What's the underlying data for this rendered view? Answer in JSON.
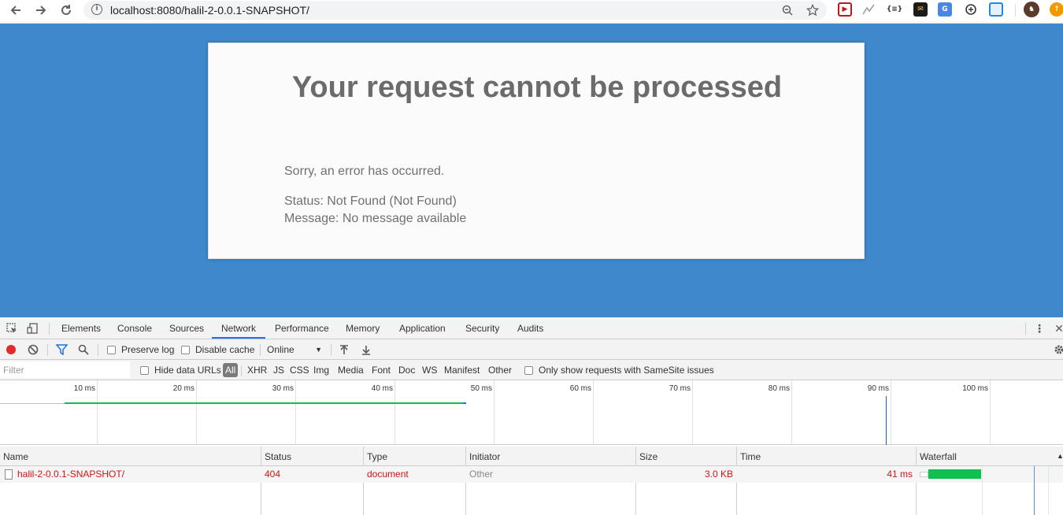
{
  "browser": {
    "url": "localhost:8080/halil-2-0.0.1-SNAPSHOT/",
    "extensions": [
      "zoom-icon",
      "bookmark-star-icon",
      "video-extension-icon",
      "trend-extension-icon",
      "json-extension-icon",
      "mail-extension-icon",
      "translate-extension-icon",
      "sync-extension-icon",
      "window-extension-icon",
      "profile-avatar-icon",
      "update-icon"
    ]
  },
  "page": {
    "title": "Your request cannot be processed",
    "sorry": "Sorry, an error has occurred.",
    "status": "Status: Not Found (Not Found)",
    "message": "Message: No message available",
    "background": "#3f88cb"
  },
  "devtools": {
    "tabs": [
      "Elements",
      "Console",
      "Sources",
      "Network",
      "Performance",
      "Memory",
      "Application",
      "Security",
      "Audits"
    ],
    "active_tab": "Network",
    "toolbar": {
      "preserve_log": "Preserve log",
      "disable_cache": "Disable cache",
      "throttling": "Online"
    },
    "filter": {
      "placeholder": "Filter",
      "hide_data_urls": "Hide data URLs",
      "types": [
        "All",
        "XHR",
        "JS",
        "CSS",
        "Img",
        "Media",
        "Font",
        "Doc",
        "WS",
        "Manifest",
        "Other"
      ],
      "selected_type": "All",
      "samesite": "Only show requests with SameSite issues"
    },
    "overview_ticks": [
      "10 ms",
      "20 ms",
      "30 ms",
      "40 ms",
      "50 ms",
      "60 ms",
      "70 ms",
      "80 ms",
      "90 ms",
      "100 ms"
    ],
    "columns": [
      "Name",
      "Status",
      "Type",
      "Initiator",
      "Size",
      "Time",
      "Waterfall"
    ],
    "requests": [
      {
        "name": "halil-2-0.0.1-SNAPSHOT/",
        "status": "404",
        "type": "document",
        "initiator": "Other",
        "size": "3.0 KB",
        "time": "41 ms"
      }
    ]
  }
}
